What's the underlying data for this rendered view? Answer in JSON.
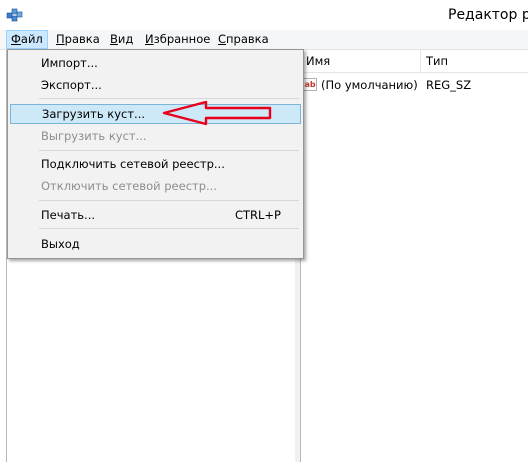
{
  "window": {
    "title": "Редактор р"
  },
  "menubar": {
    "items": [
      {
        "label": "Файл",
        "key": "Ф",
        "rest": "айл"
      },
      {
        "label": "Правка",
        "key": "П",
        "rest": "равка"
      },
      {
        "label": "Вид",
        "key": "В",
        "rest": "ид"
      },
      {
        "label": "Избранное",
        "key": "И",
        "rest": "збранное"
      },
      {
        "label": "Справка",
        "key": "С",
        "rest": "правка"
      }
    ]
  },
  "file_menu": {
    "import": "Импорт...",
    "export": "Экспорт...",
    "load_hive": "Загрузить куст...",
    "unload_hive": "Выгрузить куст...",
    "connect_network": "Подключить сетевой реестр...",
    "disconnect_network": "Отключить сетевой реестр...",
    "print": "Печать...",
    "print_shortcut": "CTRL+P",
    "exit": "Выход"
  },
  "values_list": {
    "columns": [
      "Имя",
      "Тип"
    ],
    "rows": [
      {
        "icon": "ab",
        "name": "(По умолчанию)",
        "type": "REG_SZ"
      }
    ]
  },
  "annotation": {
    "arrow_color": "#e8001c"
  }
}
